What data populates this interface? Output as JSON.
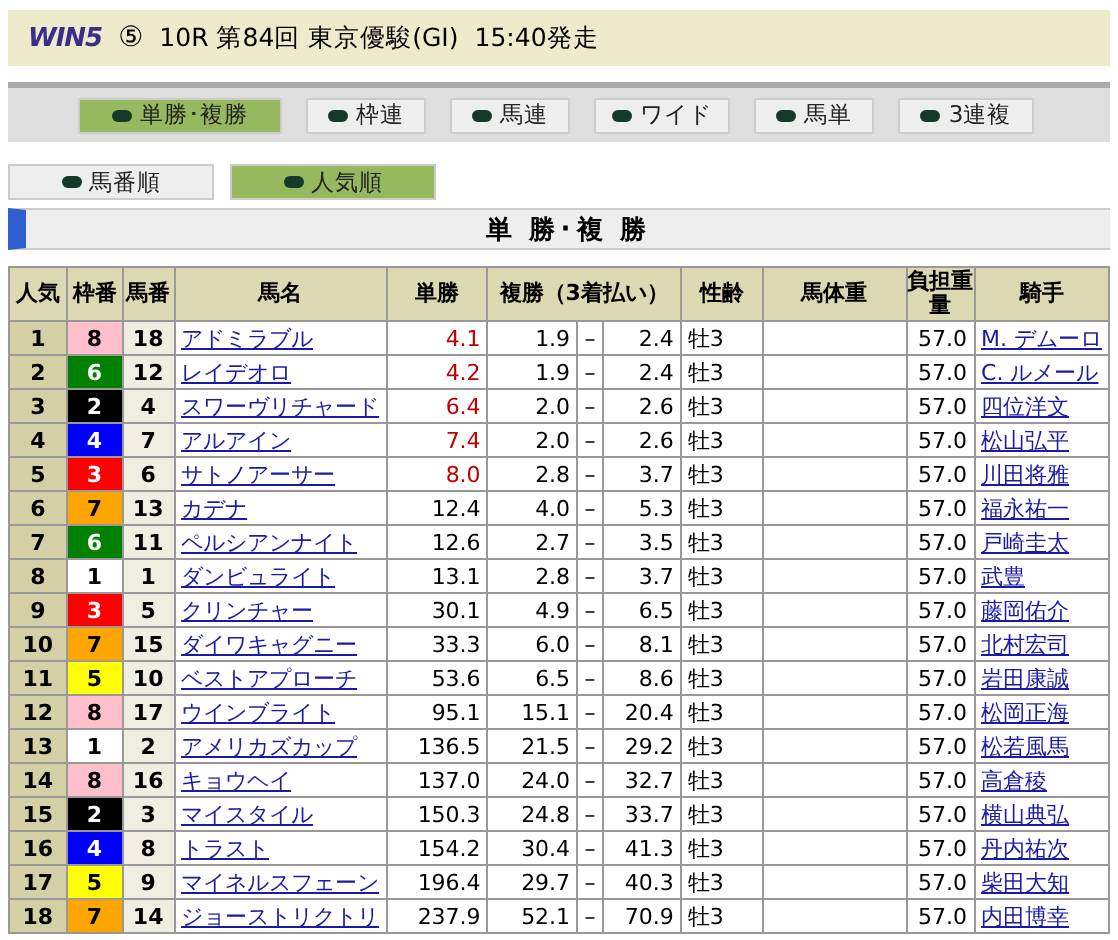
{
  "header": {
    "logo": "WIN5",
    "leg": "⑤",
    "race": "10R 第84回 東京優駿(GI)",
    "start": "15:40発走"
  },
  "bet_tabs": [
    {
      "label": "単勝･複勝",
      "selected": true
    },
    {
      "label": "枠連",
      "selected": false
    },
    {
      "label": "馬連",
      "selected": false
    },
    {
      "label": "ワイド",
      "selected": false
    },
    {
      "label": "馬単",
      "selected": false
    },
    {
      "label": "3連複",
      "selected": false
    }
  ],
  "sort_tabs": [
    {
      "label": "馬番順",
      "selected": false
    },
    {
      "label": "人気順",
      "selected": true
    }
  ],
  "section_title": "単 勝･複 勝",
  "table": {
    "columns": [
      "人気",
      "枠番",
      "馬番",
      "馬名",
      "単勝",
      "複勝（3着払い）",
      "性齢",
      "馬体重",
      "負担重量",
      "騎手"
    ],
    "rows": [
      {
        "popularity": "1",
        "frame": "8",
        "color": "#ffc0cb",
        "number": "18",
        "horse": "アドミラブル",
        "win": "4.1",
        "low_odds": true,
        "place_low": "1.9",
        "dash": "–",
        "place_high": "2.4",
        "sex_age": "牡3",
        "weight": "57.0",
        "jockey": "M. デムーロ"
      },
      {
        "popularity": "2",
        "frame": "6",
        "color": "#008000",
        "number": "12",
        "horse": "レイデオロ",
        "win": "4.2",
        "low_odds": true,
        "place_low": "1.9",
        "dash": "–",
        "place_high": "2.4",
        "sex_age": "牡3",
        "weight": "57.0",
        "jockey": "C. ルメール"
      },
      {
        "popularity": "3",
        "frame": "2",
        "color": "#000000",
        "number": "4",
        "horse": "スワーヴリチャード",
        "win": "6.4",
        "low_odds": true,
        "place_low": "2.0",
        "dash": "–",
        "place_high": "2.6",
        "sex_age": "牡3",
        "weight": "57.0",
        "jockey": "四位洋文"
      },
      {
        "popularity": "4",
        "frame": "4",
        "color": "#0000ff",
        "number": "7",
        "horse": "アルアイン",
        "win": "7.4",
        "low_odds": true,
        "place_low": "2.0",
        "dash": "–",
        "place_high": "2.6",
        "sex_age": "牡3",
        "weight": "57.0",
        "jockey": "松山弘平"
      },
      {
        "popularity": "5",
        "frame": "3",
        "color": "#ff0000",
        "number": "6",
        "horse": "サトノアーサー",
        "win": "8.0",
        "low_odds": true,
        "place_low": "2.8",
        "dash": "–",
        "place_high": "3.7",
        "sex_age": "牡3",
        "weight": "57.0",
        "jockey": "川田将雅"
      },
      {
        "popularity": "6",
        "frame": "7",
        "color": "#ffa500",
        "number": "13",
        "horse": "カデナ",
        "win": "12.4",
        "low_odds": false,
        "place_low": "4.0",
        "dash": "–",
        "place_high": "5.3",
        "sex_age": "牡3",
        "weight": "57.0",
        "jockey": "福永祐一"
      },
      {
        "popularity": "7",
        "frame": "6",
        "color": "#008000",
        "number": "11",
        "horse": "ペルシアンナイト",
        "win": "12.6",
        "low_odds": false,
        "place_low": "2.7",
        "dash": "–",
        "place_high": "3.5",
        "sex_age": "牡3",
        "weight": "57.0",
        "jockey": "戸崎圭太"
      },
      {
        "popularity": "8",
        "frame": "1",
        "color": "#ffffff",
        "number": "1",
        "horse": "ダンビュライト",
        "win": "13.1",
        "low_odds": false,
        "place_low": "2.8",
        "dash": "–",
        "place_high": "3.7",
        "sex_age": "牡3",
        "weight": "57.0",
        "jockey": "武豊"
      },
      {
        "popularity": "9",
        "frame": "3",
        "color": "#ff0000",
        "number": "5",
        "horse": "クリンチャー",
        "win": "30.1",
        "low_odds": false,
        "place_low": "4.9",
        "dash": "–",
        "place_high": "6.5",
        "sex_age": "牡3",
        "weight": "57.0",
        "jockey": "藤岡佑介"
      },
      {
        "popularity": "10",
        "frame": "7",
        "color": "#ffa500",
        "number": "15",
        "horse": "ダイワキャグニー",
        "win": "33.3",
        "low_odds": false,
        "place_low": "6.0",
        "dash": "–",
        "place_high": "8.1",
        "sex_age": "牡3",
        "weight": "57.0",
        "jockey": "北村宏司"
      },
      {
        "popularity": "11",
        "frame": "5",
        "color": "#ffff00",
        "number": "10",
        "horse": "ベストアプローチ",
        "win": "53.6",
        "low_odds": false,
        "place_low": "6.5",
        "dash": "–",
        "place_high": "8.6",
        "sex_age": "牡3",
        "weight": "57.0",
        "jockey": "岩田康誠"
      },
      {
        "popularity": "12",
        "frame": "8",
        "color": "#ffc0cb",
        "number": "17",
        "horse": "ウインブライト",
        "win": "95.1",
        "low_odds": false,
        "place_low": "15.1",
        "dash": "–",
        "place_high": "20.4",
        "sex_age": "牡3",
        "weight": "57.0",
        "jockey": "松岡正海"
      },
      {
        "popularity": "13",
        "frame": "1",
        "color": "#ffffff",
        "number": "2",
        "horse": "アメリカズカップ",
        "win": "136.5",
        "low_odds": false,
        "place_low": "21.5",
        "dash": "–",
        "place_high": "29.2",
        "sex_age": "牡3",
        "weight": "57.0",
        "jockey": "松若風馬"
      },
      {
        "popularity": "14",
        "frame": "8",
        "color": "#ffc0cb",
        "number": "16",
        "horse": "キョウヘイ",
        "win": "137.0",
        "low_odds": false,
        "place_low": "24.0",
        "dash": "–",
        "place_high": "32.7",
        "sex_age": "牡3",
        "weight": "57.0",
        "jockey": "高倉稜"
      },
      {
        "popularity": "15",
        "frame": "2",
        "color": "#000000",
        "number": "3",
        "horse": "マイスタイル",
        "win": "150.3",
        "low_odds": false,
        "place_low": "24.8",
        "dash": "–",
        "place_high": "33.7",
        "sex_age": "牡3",
        "weight": "57.0",
        "jockey": "横山典弘"
      },
      {
        "popularity": "16",
        "frame": "4",
        "color": "#0000ff",
        "number": "8",
        "horse": "トラスト",
        "win": "154.2",
        "low_odds": false,
        "place_low": "30.4",
        "dash": "–",
        "place_high": "41.3",
        "sex_age": "牡3",
        "weight": "57.0",
        "jockey": "丹内祐次"
      },
      {
        "popularity": "17",
        "frame": "5",
        "color": "#ffff00",
        "number": "9",
        "horse": "マイネルスフェーン",
        "win": "196.4",
        "low_odds": false,
        "place_low": "29.7",
        "dash": "–",
        "place_high": "40.3",
        "sex_age": "牡3",
        "weight": "57.0",
        "jockey": "柴田大知"
      },
      {
        "popularity": "18",
        "frame": "7",
        "color": "#ffa500",
        "number": "14",
        "horse": "ジョーストリクトリ",
        "win": "237.9",
        "low_odds": false,
        "place_low": "52.1",
        "dash": "–",
        "place_high": "70.9",
        "sex_age": "牡3",
        "weight": "57.0",
        "jockey": "内田博幸"
      }
    ]
  }
}
